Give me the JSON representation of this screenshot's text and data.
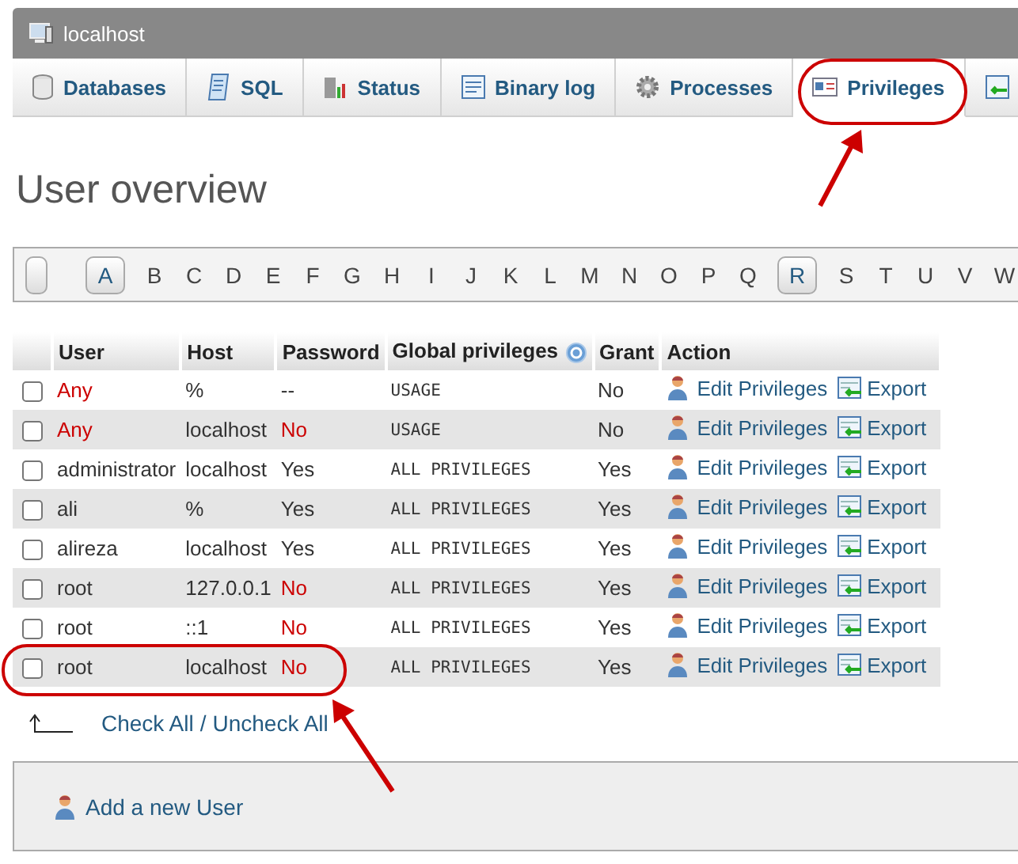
{
  "window": {
    "title": "localhost"
  },
  "tabs": [
    {
      "label": "Databases",
      "selected": false
    },
    {
      "label": "SQL",
      "selected": false
    },
    {
      "label": "Status",
      "selected": false
    },
    {
      "label": "Binary log",
      "selected": false
    },
    {
      "label": "Processes",
      "selected": false
    },
    {
      "label": "Privileges",
      "selected": true
    },
    {
      "selected": false
    }
  ],
  "heading": "User overview",
  "letters": [
    {
      "label": "A",
      "selected": true
    },
    {
      "label": "B",
      "selected": false
    },
    {
      "label": "C",
      "selected": false
    },
    {
      "label": "D",
      "selected": false
    },
    {
      "label": "E",
      "selected": false
    },
    {
      "label": "F",
      "selected": false
    },
    {
      "label": "G",
      "selected": false
    },
    {
      "label": "H",
      "selected": false
    },
    {
      "label": "I",
      "selected": false
    },
    {
      "label": "J",
      "selected": false
    },
    {
      "label": "K",
      "selected": false
    },
    {
      "label": "L",
      "selected": false
    },
    {
      "label": "M",
      "selected": false
    },
    {
      "label": "N",
      "selected": false
    },
    {
      "label": "O",
      "selected": false
    },
    {
      "label": "P",
      "selected": false
    },
    {
      "label": "Q",
      "selected": false
    },
    {
      "label": "R",
      "selected": true
    },
    {
      "label": "S",
      "selected": false
    },
    {
      "label": "T",
      "selected": false
    },
    {
      "label": "U",
      "selected": false
    },
    {
      "label": "V",
      "selected": false
    },
    {
      "label": "W",
      "selected": false
    }
  ],
  "table": {
    "columns": [
      "User",
      "Host",
      "Password",
      "Global privileges",
      "Grant",
      "Action"
    ],
    "rows": [
      {
        "checked": false,
        "user": "Any",
        "anonymous": true,
        "host": "%",
        "password": "--",
        "no_password": false,
        "privileges": "USAGE",
        "grant": "No",
        "actions": [
          "Edit Privileges",
          "Export"
        ]
      },
      {
        "checked": false,
        "user": "Any",
        "anonymous": true,
        "host": "localhost",
        "password": "No",
        "no_password": true,
        "privileges": "USAGE",
        "grant": "No",
        "actions": [
          "Edit Privileges",
          "Export"
        ]
      },
      {
        "checked": false,
        "user": "administrator",
        "anonymous": false,
        "host": "localhost",
        "password": "Yes",
        "no_password": false,
        "privileges": "ALL PRIVILEGES",
        "grant": "Yes",
        "actions": [
          "Edit Privileges",
          "Export"
        ]
      },
      {
        "checked": false,
        "user": "ali",
        "anonymous": false,
        "host": "%",
        "password": "Yes",
        "no_password": false,
        "privileges": "ALL PRIVILEGES",
        "grant": "Yes",
        "actions": [
          "Edit Privileges",
          "Export"
        ]
      },
      {
        "checked": false,
        "user": "alireza",
        "anonymous": false,
        "host": "localhost",
        "password": "Yes",
        "no_password": false,
        "privileges": "ALL PRIVILEGES",
        "grant": "Yes",
        "actions": [
          "Edit Privileges",
          "Export"
        ]
      },
      {
        "checked": false,
        "user": "root",
        "anonymous": false,
        "host": "127.0.0.1",
        "password": "No",
        "no_password": true,
        "privileges": "ALL PRIVILEGES",
        "grant": "Yes",
        "actions": [
          "Edit Privileges",
          "Export"
        ]
      },
      {
        "checked": false,
        "user": "root",
        "anonymous": false,
        "host": "::1",
        "password": "No",
        "no_password": true,
        "privileges": "ALL PRIVILEGES",
        "grant": "Yes",
        "actions": [
          "Edit Privileges",
          "Export"
        ]
      },
      {
        "checked": false,
        "user": "root",
        "anonymous": false,
        "host": "localhost",
        "password": "No",
        "no_password": true,
        "privileges": "ALL PRIVILEGES",
        "grant": "Yes",
        "actions": [
          "Edit Privileges",
          "Export"
        ]
      }
    ]
  },
  "check_all": "Check All",
  "separator": "/",
  "uncheck_all": "Uncheck All",
  "add_user": "Add a new User"
}
